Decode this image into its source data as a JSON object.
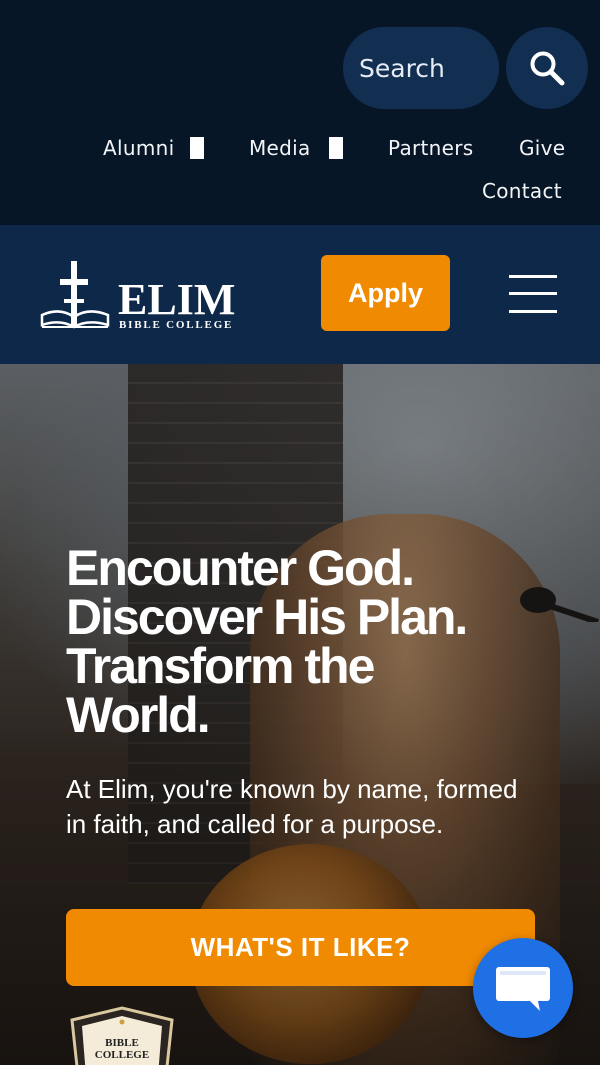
{
  "utility": {
    "search_placeholder": "Search",
    "links": {
      "alumni": "Alumni",
      "media": "Media",
      "partners": "Partners",
      "give": "Give",
      "contact": "Contact"
    }
  },
  "nav": {
    "logo_title": "ELIM",
    "logo_subtitle": "BIBLE COLLEGE",
    "apply_label": "Apply"
  },
  "hero": {
    "title_lines": [
      "Encounter God.",
      "Discover His Plan.",
      "Transform the",
      "World."
    ],
    "subtitle": "At Elim, you're known by name, formed in faith, and called for a purpose.",
    "cta_label": "WHAT'S IT LIKE?",
    "badge_text_line1": "BIBLE",
    "badge_text_line2": "COLLEGE"
  },
  "colors": {
    "utility_bg": "#071627",
    "nav_bg": "#0e2849",
    "accent_orange": "#f08a00",
    "chat_blue": "#1f6fe5"
  },
  "icons": {
    "search": "search-icon",
    "menu": "hamburger-menu-icon",
    "chat": "chat-bubble-icon",
    "external": "external-link-icon"
  }
}
